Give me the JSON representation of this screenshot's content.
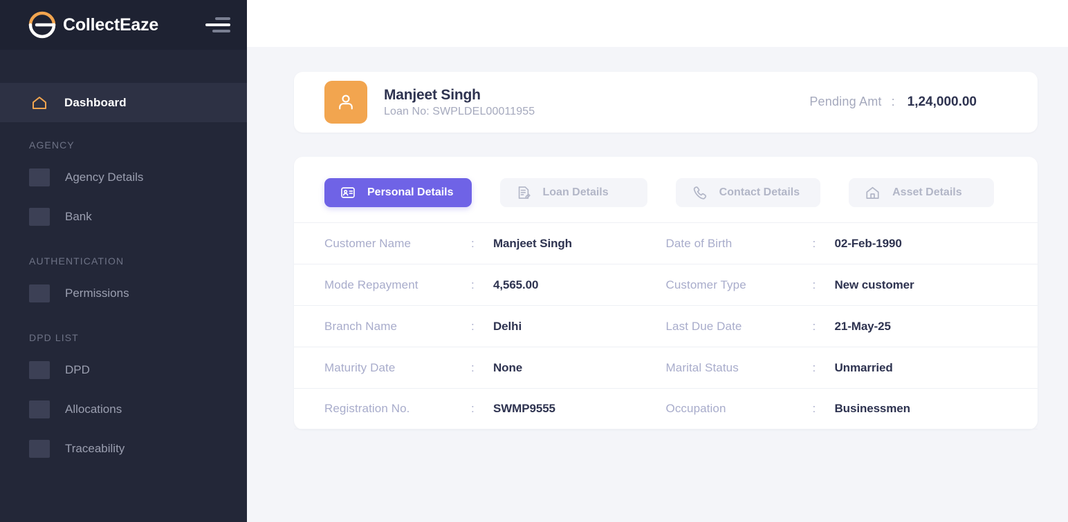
{
  "brand": {
    "name": "CollectEaze",
    "logo_icon": "collecteaze-logo-icon",
    "logo_arc_color": "#f2a54f",
    "menu_icon": "hamburger-menu-icon"
  },
  "sidebar": {
    "background": "#232738",
    "active_background": "#2d3144",
    "accent": "#f2a54f",
    "items": [
      {
        "label": "Dashboard",
        "icon": "home-icon",
        "active": true
      }
    ],
    "sections": [
      {
        "title": "AGENCY",
        "items": [
          {
            "label": "Agency Details",
            "icon": "placeholder-icon"
          },
          {
            "label": "Bank",
            "icon": "placeholder-icon"
          }
        ]
      },
      {
        "title": "AUTHENTICATION",
        "items": [
          {
            "label": "Permissions",
            "icon": "placeholder-icon"
          }
        ]
      },
      {
        "title": "DPD LIST",
        "items": [
          {
            "label": "DPD",
            "icon": "placeholder-icon"
          },
          {
            "label": "Allocations",
            "icon": "placeholder-icon"
          },
          {
            "label": "Traceability",
            "icon": "placeholder-icon"
          }
        ]
      }
    ]
  },
  "customer_header": {
    "avatar_icon": "user-icon",
    "avatar_color": "#f2a54f",
    "name": "Manjeet Singh",
    "loan_no": "Loan No: SWPLDEL00011955",
    "pending_label": "Pending Amt",
    "pending_colon": ":",
    "pending_value": "1,24,000.00"
  },
  "tabs": [
    {
      "label": "Personal Details",
      "icon": "id-card-icon",
      "active": true
    },
    {
      "label": "Loan Details",
      "icon": "document-edit-icon",
      "active": false
    },
    {
      "label": "Contact Details",
      "icon": "phone-icon",
      "active": false
    },
    {
      "label": "Asset Details",
      "icon": "house-icon",
      "active": false
    }
  ],
  "tab_colors": {
    "active_bg": "#6f63e6",
    "inactive_bg": "#f4f5f9",
    "inactive_text": "#b2b6c7"
  },
  "details": {
    "separator": ":",
    "rows": [
      {
        "left": {
          "key": "Customer Name",
          "value": "Manjeet Singh"
        },
        "right": {
          "key": "Date of Birth",
          "value": "02-Feb-1990"
        }
      },
      {
        "left": {
          "key": "Mode Repayment",
          "value": "4,565.00"
        },
        "right": {
          "key": "Customer Type",
          "value": "New customer"
        }
      },
      {
        "left": {
          "key": "Branch Name",
          "value": "Delhi"
        },
        "right": {
          "key": "Last Due Date",
          "value": "21-May-25"
        }
      },
      {
        "left": {
          "key": "Maturity Date",
          "value": "None"
        },
        "right": {
          "key": "Marital Status",
          "value": "Unmarried"
        }
      },
      {
        "left": {
          "key": "Registration No.",
          "value": "SWMP9555"
        },
        "right": {
          "key": "Occupation",
          "value": "Businessmen"
        }
      }
    ]
  }
}
